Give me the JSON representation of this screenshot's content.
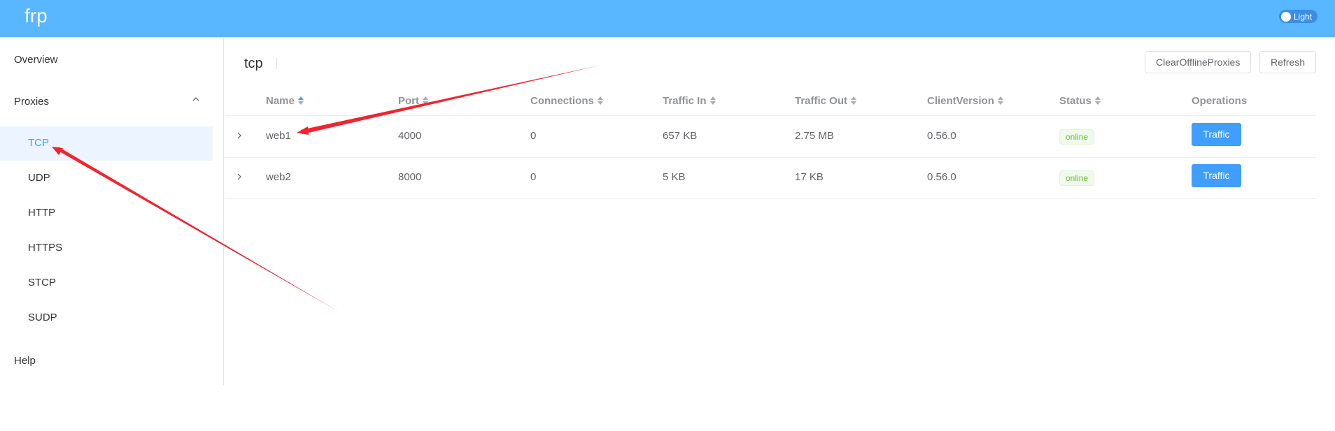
{
  "header": {
    "app_name": "frp",
    "theme_toggle_label": "Light",
    "background_color": "#58b7ff"
  },
  "sidebar": {
    "overview": "Overview",
    "proxies": "Proxies",
    "proxies_expanded": true,
    "proxy_types": [
      "TCP",
      "UDP",
      "HTTP",
      "HTTPS",
      "STCP",
      "SUDP"
    ],
    "active_proxy_type": "TCP",
    "help": "Help"
  },
  "main": {
    "title": "tcp",
    "buttons": {
      "clear_offline": "ClearOfflineProxies",
      "refresh": "Refresh"
    },
    "table": {
      "columns": [
        "Name",
        "Port",
        "Connections",
        "Traffic In",
        "Traffic Out",
        "ClientVersion",
        "Status",
        "Operations"
      ],
      "sorted_column": "Name",
      "rows": [
        {
          "name": "web1",
          "port": "4000",
          "connections": "0",
          "traffic_in": "657 KB",
          "traffic_out": "2.75 MB",
          "client_version": "0.56.0",
          "status": "online",
          "operation": "Traffic"
        },
        {
          "name": "web2",
          "port": "8000",
          "connections": "0",
          "traffic_in": "5 KB",
          "traffic_out": "17 KB",
          "client_version": "0.56.0",
          "status": "online",
          "operation": "Traffic"
        }
      ]
    }
  },
  "colors": {
    "accent": "#409eff",
    "status_online": "#67c23a",
    "annotation_arrow": "#f5222d"
  },
  "icons": {
    "submenu_toggle": "chevron-up-icon",
    "row_expand": "chevron-right-icon",
    "sort": "sort-caret-icon"
  }
}
